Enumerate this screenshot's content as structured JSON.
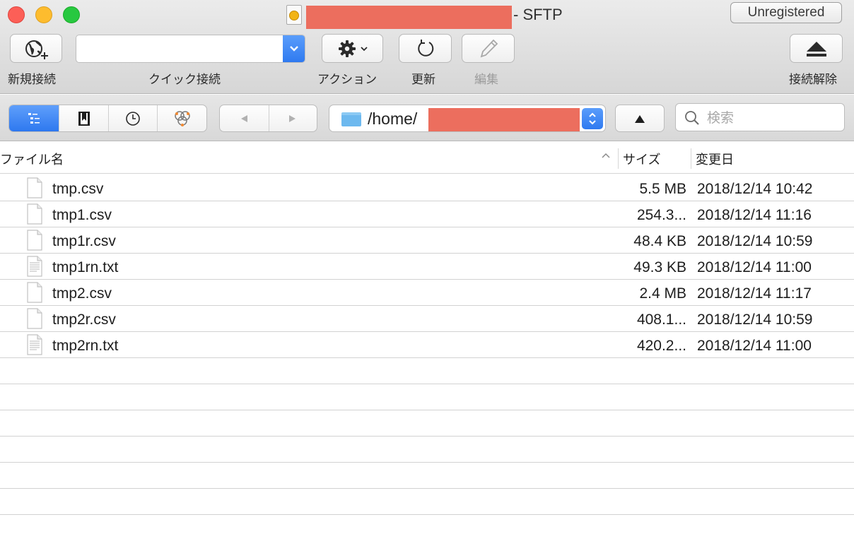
{
  "window": {
    "title_suffix": "- SFTP",
    "unregistered_label": "Unregistered"
  },
  "toolbar": {
    "new_connection_label": "新規接続",
    "quick_connect_label": "クイック接続",
    "quick_connect_value": "",
    "action_label": "アクション",
    "refresh_label": "更新",
    "edit_label": "編集",
    "disconnect_label": "接続解除"
  },
  "navigation": {
    "path": "/home/",
    "search_placeholder": "検索",
    "view_modes": [
      "browser",
      "bookmarks",
      "history",
      "bonjour"
    ],
    "active_view": "browser"
  },
  "columns": {
    "name": "ファイル名",
    "size": "サイズ",
    "modified": "変更日"
  },
  "files": [
    {
      "name": "tmp.csv",
      "size": "5.5 MB",
      "modified": "2018/12/14 10:42",
      "icon": "blank-file-icon"
    },
    {
      "name": "tmp1.csv",
      "size": "254.3...",
      "modified": "2018/12/14 11:16",
      "icon": "blank-file-icon"
    },
    {
      "name": "tmp1r.csv",
      "size": "48.4 KB",
      "modified": "2018/12/14 10:59",
      "icon": "blank-file-icon"
    },
    {
      "name": "tmp1rn.txt",
      "size": "49.3 KB",
      "modified": "2018/12/14 11:00",
      "icon": "text-file-icon"
    },
    {
      "name": "tmp2.csv",
      "size": "2.4 MB",
      "modified": "2018/12/14 11:17",
      "icon": "blank-file-icon"
    },
    {
      "name": "tmp2r.csv",
      "size": "408.1...",
      "modified": "2018/12/14 10:59",
      "icon": "blank-file-icon"
    },
    {
      "name": "tmp2rn.txt",
      "size": "420.2...",
      "modified": "2018/12/14 11:00",
      "icon": "text-file-icon"
    }
  ],
  "colors": {
    "accent_blue": "#2f7af0",
    "redaction": "#ec6e5e",
    "folder": "#6db9ef"
  }
}
